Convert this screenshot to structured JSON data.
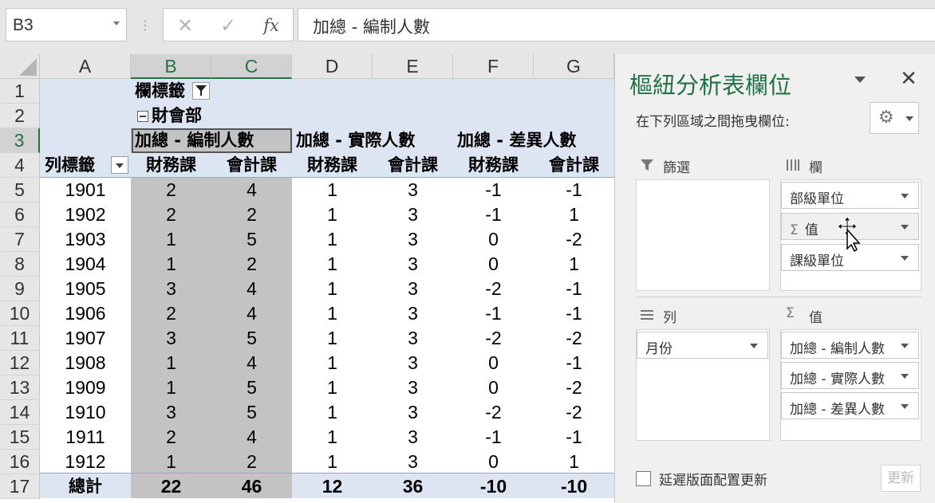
{
  "name_box": "B3",
  "formula": "加總 - 編制人數",
  "formula_buttons": {
    "cancel": "✕",
    "enter": "✓",
    "fx": "fx"
  },
  "columns": [
    "A",
    "B",
    "C",
    "D",
    "E",
    "F",
    "G"
  ],
  "rows": [
    "1",
    "2",
    "3",
    "4",
    "5",
    "6",
    "7",
    "8",
    "9",
    "10",
    "11",
    "12",
    "13",
    "14",
    "15",
    "16",
    "17"
  ],
  "pivot": {
    "col_label": "欄標籤",
    "dept": "財會部",
    "row_label": "列標籤",
    "measures": [
      "加總 - 編制人數",
      "加總 - 實際人數",
      "加總 - 差異人數"
    ],
    "sub_cols": [
      "財務課",
      "會計課",
      "財務課",
      "會計課",
      "財務課",
      "會計課"
    ],
    "data": [
      [
        "1901",
        "2",
        "4",
        "1",
        "3",
        "-1",
        "-1"
      ],
      [
        "1902",
        "2",
        "2",
        "1",
        "3",
        "-1",
        "1"
      ],
      [
        "1903",
        "1",
        "5",
        "1",
        "3",
        "0",
        "-2"
      ],
      [
        "1904",
        "1",
        "2",
        "1",
        "3",
        "0",
        "1"
      ],
      [
        "1905",
        "3",
        "4",
        "1",
        "3",
        "-2",
        "-1"
      ],
      [
        "1906",
        "2",
        "4",
        "1",
        "3",
        "-1",
        "-1"
      ],
      [
        "1907",
        "3",
        "5",
        "1",
        "3",
        "-2",
        "-2"
      ],
      [
        "1908",
        "1",
        "4",
        "1",
        "3",
        "0",
        "-1"
      ],
      [
        "1909",
        "1",
        "5",
        "1",
        "3",
        "0",
        "-2"
      ],
      [
        "1910",
        "3",
        "5",
        "1",
        "3",
        "-2",
        "-2"
      ],
      [
        "1911",
        "2",
        "4",
        "1",
        "3",
        "-1",
        "-1"
      ],
      [
        "1912",
        "1",
        "2",
        "1",
        "3",
        "0",
        "1"
      ]
    ],
    "total": [
      "總計",
      "22",
      "46",
      "12",
      "36",
      "-10",
      "-10"
    ]
  },
  "pane": {
    "title": "樞紐分析表欄位",
    "subtitle": "在下列區域之間拖曳欄位:",
    "close_icon": "✕",
    "filters_label": "篩選",
    "columns_label": "欄",
    "rows_label": "列",
    "values_label": "值",
    "sigma": "Σ",
    "column_chips": [
      "部級單位",
      "值",
      "課級單位"
    ],
    "row_chips": [
      "月份"
    ],
    "value_chips": [
      "加總 - 編制人數",
      "加總 - 實際人數",
      "加總 - 差異人數"
    ],
    "defer_label": "延遲版面配置更新",
    "update_label": "更新"
  },
  "colors": {
    "accent": "#217346",
    "pivot_band": "#dde4f2",
    "selection": "#c3c3c3"
  }
}
